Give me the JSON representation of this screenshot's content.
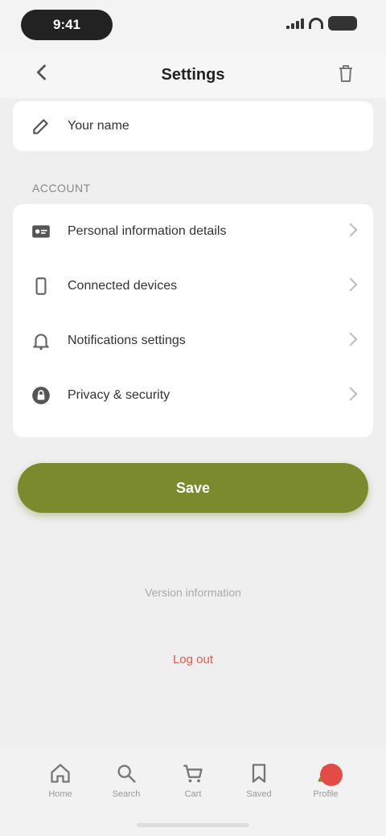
{
  "status_bar": {
    "time": "9:41"
  },
  "nav": {
    "title": "Settings"
  },
  "top_card": {
    "label": "Your name"
  },
  "section": {
    "title": "ACCOUNT"
  },
  "list_items": [
    {
      "label": "Personal information details"
    },
    {
      "label": "Connected devices"
    },
    {
      "label": "Notifications settings"
    },
    {
      "label": "Privacy & security"
    }
  ],
  "primary_button": {
    "label": "Save"
  },
  "hint": {
    "text": "Version information"
  },
  "danger": {
    "label": "Log out"
  },
  "tabs": [
    {
      "label": "Home",
      "icon": "home-icon"
    },
    {
      "label": "Search",
      "icon": "search-icon"
    },
    {
      "label": "Cart",
      "icon": "cart-icon"
    },
    {
      "label": "Saved",
      "icon": "bookmark-icon"
    },
    {
      "label": "Profile",
      "icon": "profile-icon"
    }
  ],
  "colors": {
    "accent": "#7a8a2c",
    "danger": "#e05a4a",
    "badge": "#e34b46"
  }
}
